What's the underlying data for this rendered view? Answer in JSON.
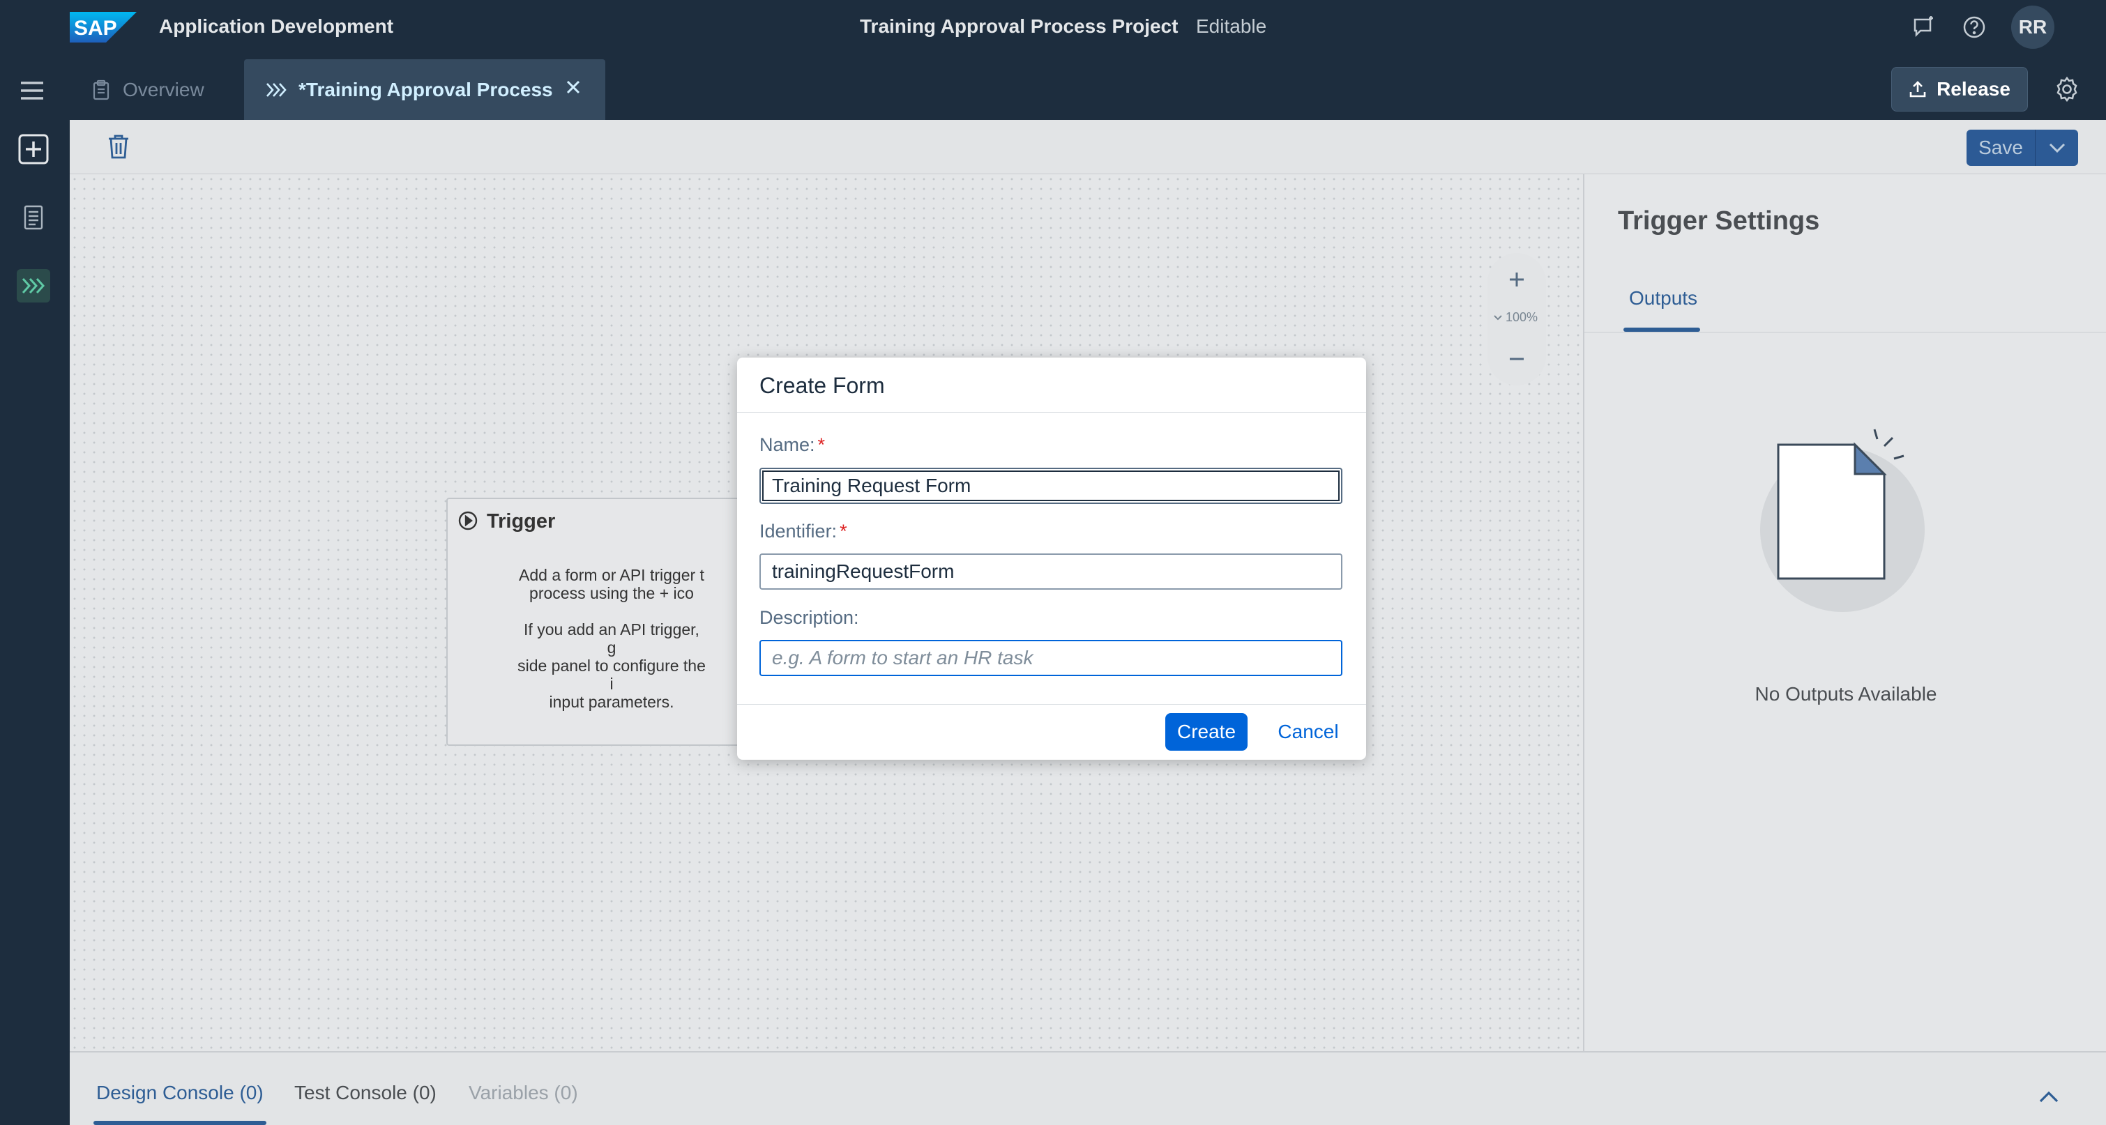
{
  "shell": {
    "logo_text": "SAP",
    "app_title": "Application Development",
    "project_title": "Training Approval Process Project",
    "project_status": "Editable",
    "avatar_initials": "RR"
  },
  "tabs": {
    "overview_label": "Overview",
    "active_label": "*Training Approval Process",
    "release_label": "Release"
  },
  "toolbar": {
    "save_label": "Save"
  },
  "canvas": {
    "zoom_level": "100%",
    "trigger_title": "Trigger",
    "trigger_text": "Add a form or API trigger t\nprocess using the + ico\n\nIf you add an API trigger, g\nside panel to configure the i\ninput parameters."
  },
  "panel": {
    "title": "Trigger Settings",
    "tab_outputs": "Outputs",
    "empty_text": "No Outputs Available"
  },
  "console": {
    "design_label": "Design Console (0)",
    "test_label": "Test Console (0)",
    "variables_label": "Variables (0)"
  },
  "dialog": {
    "title": "Create Form",
    "name_label": "Name:",
    "name_value": "Training Request Form",
    "identifier_label": "Identifier:",
    "identifier_value": "trainingRequestForm",
    "description_label": "Description:",
    "description_placeholder": "e.g. A form to start an HR task",
    "required_mark": "*",
    "create_label": "Create",
    "cancel_label": "Cancel"
  },
  "colors": {
    "shell_bg": "#1d2d3e",
    "accent": "#0064d9",
    "tab_active_bg": "#354a5f",
    "required": "#dd2222"
  }
}
